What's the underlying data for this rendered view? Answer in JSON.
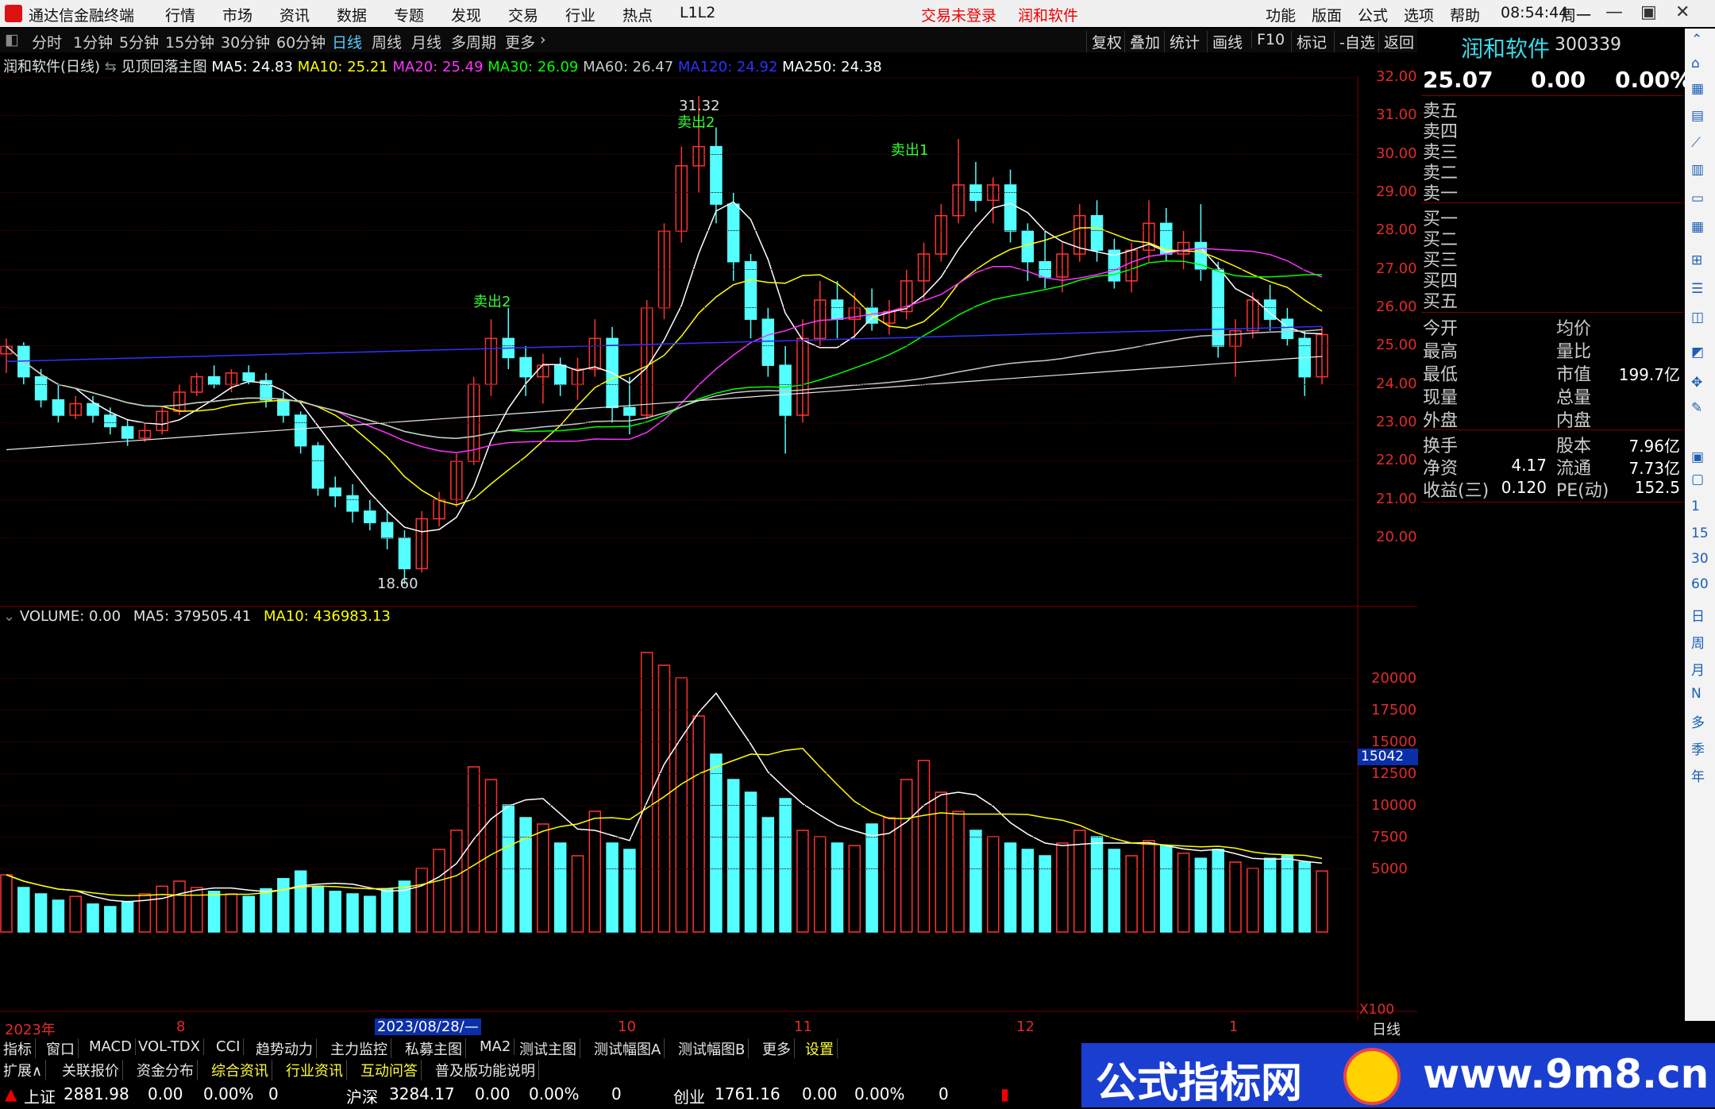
{
  "titlebar": {
    "app_name": "通达信金融终端",
    "menus": [
      "行情",
      "市场",
      "资讯",
      "数据",
      "专题",
      "发现",
      "交易",
      "行业",
      "热点",
      "L1L2"
    ],
    "login_status": "交易未登录",
    "stock_title": "润和软件",
    "right_menus": [
      "功能",
      "版面",
      "公式",
      "选项",
      "帮助"
    ],
    "clock": "08:54:44",
    "weekday": "周一"
  },
  "periods": [
    "分时",
    "1分钟",
    "5分钟",
    "15分钟",
    "30分钟",
    "60分钟",
    "日线",
    "周线",
    "月线",
    "多周期",
    "更多"
  ],
  "active_period": "日线",
  "toolbar_right": [
    "复权",
    "叠加",
    "统计",
    "画线",
    "F10",
    "标记",
    "-自选",
    "返回"
  ],
  "main_info": {
    "title": "润和软件(日线)",
    "indicator": "见顶回落主图",
    "ma": [
      {
        "label": "MA5: 24.83",
        "color": "#ffffff"
      },
      {
        "label": "MA10: 25.21",
        "color": "#ffff00"
      },
      {
        "label": "MA20: 25.49",
        "color": "#ff33ff"
      },
      {
        "label": "MA30: 26.09",
        "color": "#00ff00"
      },
      {
        "label": "MA60: 26.47",
        "color": "#c8c8c8"
      },
      {
        "label": "MA120: 24.92",
        "color": "#3030ff"
      },
      {
        "label": "MA250: 24.38",
        "color": "#ffffff"
      }
    ]
  },
  "price_axis": [
    "32.00",
    "31.00",
    "30.00",
    "29.00",
    "28.00",
    "27.00",
    "26.00",
    "25.00",
    "24.00",
    "23.00",
    "22.00",
    "21.00",
    "20.00"
  ],
  "annotations": {
    "high": "31.32",
    "low": "18.60",
    "sell_labels": [
      "卖出2",
      "卖出2",
      "卖出1"
    ]
  },
  "volume_info": {
    "title": "VOLUME: 0.00",
    "ma5": "MA5: 379505.41",
    "ma10": "MA10: 436983.13"
  },
  "volume_axis": [
    "20000",
    "17500",
    "15000",
    "12500",
    "10000",
    "7500",
    "5000"
  ],
  "volume_marker": "15042",
  "volume_unit": "X100",
  "x_axis": [
    "2023年",
    "8",
    "2023/08/28/—",
    "10",
    "11",
    "12",
    "1",
    "日线"
  ],
  "quote_panel": {
    "name": "润和软件",
    "code": "300339",
    "price": "25.07",
    "change": "0.00",
    "pct": "0.00%",
    "sell": [
      "卖五",
      "卖四",
      "卖三",
      "卖二",
      "卖一"
    ],
    "buy": [
      "买一",
      "买二",
      "买三",
      "买四",
      "买五"
    ],
    "stats_left": [
      "今开",
      "最高",
      "最低",
      "现量",
      "外盘"
    ],
    "stats_right": [
      "均价",
      "量比",
      "市值",
      "总量",
      "内盘"
    ],
    "market_cap": "199.7亿",
    "fund_left": [
      "换手",
      "净资",
      "收益(三)"
    ],
    "fund_left_vals": [
      "",
      "4.17",
      "0.120"
    ],
    "fund_right": [
      "股本",
      "流通",
      "PE(动)"
    ],
    "fund_right_vals": [
      "7.96亿",
      "7.73亿",
      "152.5"
    ]
  },
  "right_tools": [
    "1",
    "15",
    "30",
    "60",
    "日",
    "周",
    "月",
    "N",
    "多",
    "季",
    "年"
  ],
  "tabs1": [
    "指标",
    "窗口",
    "MACD",
    "VOL-TDX",
    "CCI",
    "趋势动力",
    "主力监控",
    "私募主图",
    "MA2",
    "测试主图",
    "测试幅图A",
    "测试幅图B",
    "更多",
    "设置"
  ],
  "tabs2": [
    "扩展∧",
    "关联报价",
    "资金分布",
    "综合资讯",
    "行业资讯",
    "互动问答",
    "普及版功能说明"
  ],
  "status": [
    {
      "name": "上证",
      "val": "2881.98",
      "chg": "0.00",
      "pct": "0.00%",
      "vol": "0"
    },
    {
      "name": "沪深",
      "val": "3284.17",
      "chg": "0.00",
      "pct": "0.00%",
      "vol": "0"
    },
    {
      "name": "创业",
      "val": "1761.16",
      "chg": "0.00",
      "pct": "0.00%",
      "vol": "0"
    }
  ],
  "banner": {
    "left": "公式指标网",
    "right": "www.9m8.cn"
  },
  "chart_data": {
    "type": "candlestick",
    "ylim": [
      18.6,
      32.0
    ],
    "candles": [
      [
        24.6,
        25.0,
        24.1,
        24.8
      ],
      [
        24.8,
        24.9,
        23.8,
        24.0
      ],
      [
        24.0,
        24.2,
        23.2,
        23.4
      ],
      [
        23.4,
        23.8,
        22.8,
        23.0
      ],
      [
        23.0,
        23.5,
        22.9,
        23.3
      ],
      [
        23.3,
        23.5,
        22.8,
        23.0
      ],
      [
        23.0,
        23.2,
        22.5,
        22.7
      ],
      [
        22.7,
        22.9,
        22.2,
        22.4
      ],
      [
        22.4,
        22.8,
        22.3,
        22.6
      ],
      [
        22.6,
        23.2,
        22.5,
        23.1
      ],
      [
        23.1,
        23.8,
        23.0,
        23.6
      ],
      [
        23.6,
        24.1,
        23.5,
        24.0
      ],
      [
        24.0,
        24.3,
        23.7,
        23.8
      ],
      [
        23.8,
        24.2,
        23.6,
        24.1
      ],
      [
        24.1,
        24.3,
        23.8,
        23.9
      ],
      [
        23.9,
        24.1,
        23.2,
        23.4
      ],
      [
        23.4,
        23.6,
        22.8,
        23.0
      ],
      [
        23.0,
        23.1,
        22.0,
        22.2
      ],
      [
        22.2,
        22.3,
        20.9,
        21.1
      ],
      [
        21.1,
        21.4,
        20.6,
        20.9
      ],
      [
        20.9,
        21.2,
        20.2,
        20.5
      ],
      [
        20.5,
        20.8,
        20.0,
        20.2
      ],
      [
        20.2,
        20.5,
        19.5,
        19.8
      ],
      [
        19.8,
        20.0,
        18.6,
        19.0
      ],
      [
        19.0,
        20.5,
        18.9,
        20.3
      ],
      [
        20.3,
        21.0,
        20.1,
        20.8
      ],
      [
        20.8,
        22.0,
        20.6,
        21.8
      ],
      [
        21.8,
        24.0,
        21.7,
        23.8
      ],
      [
        23.8,
        25.5,
        23.5,
        25.0
      ],
      [
        25.0,
        25.8,
        24.2,
        24.5
      ],
      [
        24.5,
        24.8,
        23.5,
        24.0
      ],
      [
        24.0,
        24.6,
        23.3,
        24.3
      ],
      [
        24.3,
        24.5,
        23.5,
        23.8
      ],
      [
        23.8,
        24.5,
        23.4,
        24.2
      ],
      [
        24.2,
        25.5,
        24.0,
        25.0
      ],
      [
        25.0,
        25.3,
        22.8,
        23.2
      ],
      [
        23.2,
        24.0,
        22.5,
        23.0
      ],
      [
        23.0,
        26.0,
        22.9,
        25.8
      ],
      [
        25.8,
        28.0,
        25.5,
        27.8
      ],
      [
        27.8,
        30.0,
        27.5,
        29.5
      ],
      [
        29.5,
        31.32,
        28.8,
        30.0
      ],
      [
        30.0,
        30.5,
        28.0,
        28.5
      ],
      [
        28.5,
        28.8,
        26.5,
        27.0
      ],
      [
        27.0,
        27.2,
        25.0,
        25.5
      ],
      [
        25.5,
        25.8,
        24.0,
        24.3
      ],
      [
        24.3,
        24.8,
        22.0,
        23.0
      ],
      [
        23.0,
        25.5,
        22.8,
        25.0
      ],
      [
        25.0,
        26.5,
        24.8,
        26.0
      ],
      [
        26.0,
        26.5,
        25.0,
        25.5
      ],
      [
        25.5,
        26.2,
        25.0,
        25.8
      ],
      [
        25.8,
        26.3,
        25.2,
        25.4
      ],
      [
        25.4,
        26.0,
        25.1,
        25.7
      ],
      [
        25.7,
        26.8,
        25.5,
        26.5
      ],
      [
        26.5,
        27.5,
        26.0,
        27.2
      ],
      [
        27.2,
        28.5,
        27.0,
        28.2
      ],
      [
        28.2,
        30.2,
        28.0,
        29.0
      ],
      [
        29.0,
        29.6,
        28.3,
        28.6
      ],
      [
        28.6,
        29.2,
        28.0,
        29.0
      ],
      [
        29.0,
        29.4,
        27.5,
        27.8
      ],
      [
        27.8,
        28.0,
        26.5,
        27.0
      ],
      [
        27.0,
        27.8,
        26.3,
        26.6
      ],
      [
        26.6,
        27.5,
        26.2,
        27.2
      ],
      [
        27.2,
        28.5,
        27.0,
        28.2
      ],
      [
        28.2,
        28.6,
        27.0,
        27.3
      ],
      [
        27.3,
        27.6,
        26.3,
        26.5
      ],
      [
        26.5,
        27.5,
        26.2,
        27.3
      ],
      [
        27.3,
        28.6,
        27.0,
        28.0
      ],
      [
        28.0,
        28.4,
        27.0,
        27.2
      ],
      [
        27.2,
        27.8,
        26.8,
        27.5
      ],
      [
        27.5,
        28.5,
        26.5,
        26.8
      ],
      [
        26.8,
        27.0,
        24.5,
        24.8
      ],
      [
        24.8,
        25.5,
        24.0,
        25.2
      ],
      [
        25.2,
        26.2,
        25.0,
        26.0
      ],
      [
        26.0,
        26.4,
        25.2,
        25.5
      ],
      [
        25.5,
        25.8,
        24.8,
        25.0
      ],
      [
        25.0,
        25.2,
        23.5,
        24.0
      ],
      [
        24.0,
        25.3,
        23.8,
        25.1
      ]
    ],
    "volumes": [
      4.5,
      3.5,
      3.0,
      2.5,
      2.8,
      2.2,
      2.0,
      2.4,
      3.0,
      3.6,
      4.0,
      3.5,
      3.2,
      3.0,
      2.8,
      3.4,
      4.2,
      4.8,
      3.6,
      3.2,
      3.0,
      2.8,
      3.4,
      4.0,
      5.0,
      6.5,
      8.0,
      13.0,
      12.0,
      10.0,
      9.0,
      8.5,
      7.0,
      6.0,
      9.5,
      7.0,
      6.5,
      22.0,
      21.0,
      20.0,
      17.0,
      14.0,
      12.0,
      11.0,
      9.0,
      10.5,
      8.0,
      7.5,
      7.0,
      6.8,
      8.5,
      9.0,
      12.0,
      13.5,
      11.0,
      9.5,
      8.0,
      7.5,
      7.0,
      6.5,
      6.0,
      7.0,
      8.0,
      7.5,
      6.5,
      6.0,
      7.2,
      6.8,
      6.2,
      5.8,
      6.5,
      5.5,
      5.0,
      5.8,
      6.0,
      5.5,
      4.8
    ]
  }
}
